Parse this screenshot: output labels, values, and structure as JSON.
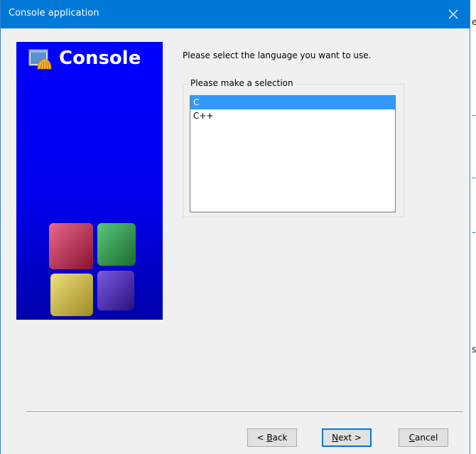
{
  "window": {
    "title": "Console application",
    "close_icon": "close-icon"
  },
  "banner": {
    "title": "Console",
    "icon": "console-app-icon",
    "background": "#0000ff"
  },
  "main": {
    "prompt": "Please select the language you want to use.",
    "group_label": "Please make a selection",
    "languages": [
      {
        "label": "C",
        "selected": true
      },
      {
        "label": "C++",
        "selected": false
      }
    ]
  },
  "buttons": {
    "back": {
      "prefix": "< ",
      "mnemonic": "B",
      "rest": "ack"
    },
    "next": {
      "mnemonic": "N",
      "rest": "ext >"
    },
    "cancel": {
      "mnemonic": "C",
      "rest": "ancel"
    }
  },
  "background_fragments": {
    "frag1": "e",
    "frag2": "s"
  },
  "colors": {
    "titlebar": "#0078d7",
    "selection": "#3399ff",
    "dialog_bg": "#f0f0f0"
  }
}
